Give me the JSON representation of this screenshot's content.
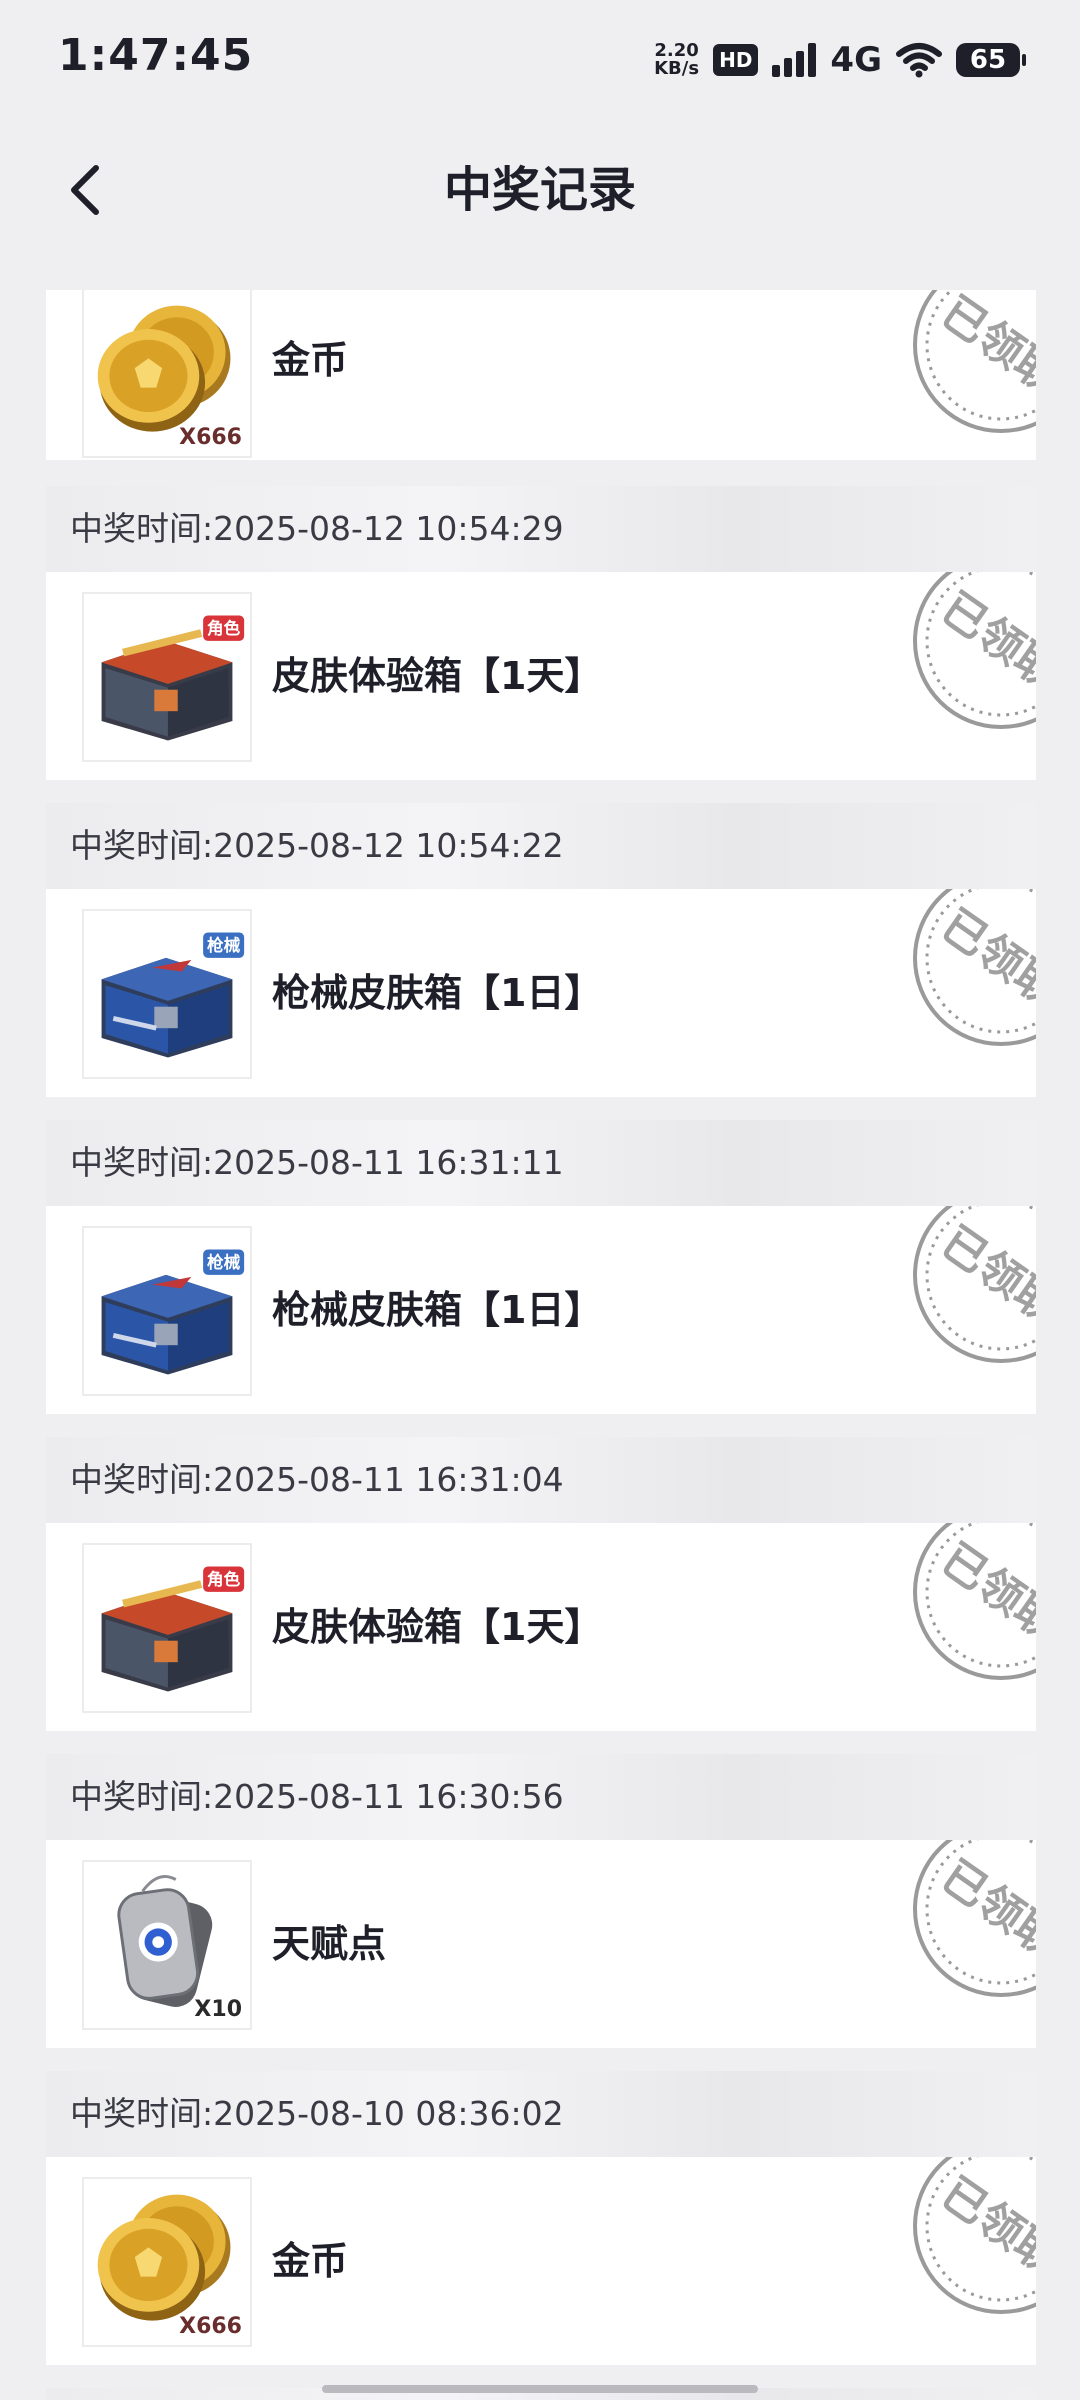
{
  "status_bar": {
    "time": "1:47:45",
    "net_speed_value": "2.20",
    "net_speed_unit": "KB/s",
    "hd_label": "HD",
    "network_type": "4G",
    "battery_level": "65"
  },
  "header": {
    "title": "中奖记录",
    "back_icon": "chevron-left-icon"
  },
  "records": [
    {
      "time_label": "",
      "item_name": "金币",
      "item_icon": "gold-coins-icon",
      "quantity": "X666",
      "badge": "",
      "status": "已领取"
    },
    {
      "time_label": "中奖时间:2025-08-12 10:54:29",
      "item_name": "皮肤体验箱【1天】",
      "item_icon": "skin-chest-icon",
      "quantity": "",
      "badge": "角色",
      "status": "已领取"
    },
    {
      "time_label": "中奖时间:2025-08-12 10:54:22",
      "item_name": "枪械皮肤箱【1日】",
      "item_icon": "weapon-chest-icon",
      "quantity": "",
      "badge": "枪械",
      "status": "已领取"
    },
    {
      "time_label": "中奖时间:2025-08-11 16:31:11",
      "item_name": "枪械皮肤箱【1日】",
      "item_icon": "weapon-chest-icon",
      "quantity": "",
      "badge": "枪械",
      "status": "已领取"
    },
    {
      "time_label": "中奖时间:2025-08-11 16:31:04",
      "item_name": "皮肤体验箱【1天】",
      "item_icon": "skin-chest-icon",
      "quantity": "",
      "badge": "角色",
      "status": "已领取"
    },
    {
      "time_label": "中奖时间:2025-08-11 16:30:56",
      "item_name": "天赋点",
      "item_icon": "dog-tag-icon",
      "quantity": "X10",
      "badge": "",
      "status": "已领取"
    },
    {
      "time_label": "中奖时间:2025-08-10 08:36:02",
      "item_name": "金币",
      "item_icon": "gold-coins-icon",
      "quantity": "X666",
      "badge": "",
      "status": "已领取"
    }
  ],
  "colors": {
    "background": "#efeff2",
    "card": "#ffffff",
    "text": "#1f1f2a",
    "stamp": "#9a9a9a",
    "badge_red": "#d8343a",
    "badge_blue": "#3a6fc2"
  }
}
